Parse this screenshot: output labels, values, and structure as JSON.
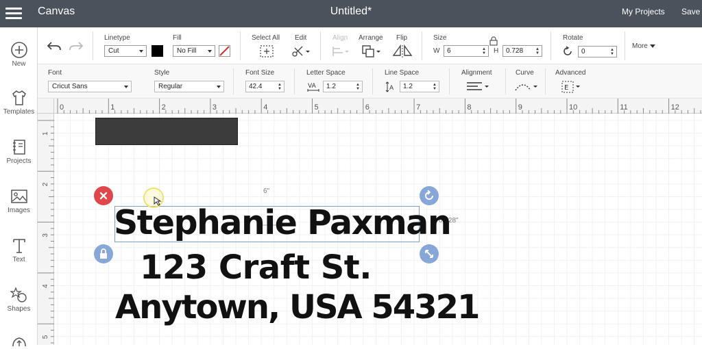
{
  "header": {
    "app_title": "Canvas",
    "doc_title": "Untitled*",
    "my_projects": "My Projects",
    "save": "Save"
  },
  "sidebar": {
    "items": [
      {
        "label": "New",
        "icon": "plus-circle-icon"
      },
      {
        "label": "Templates",
        "icon": "shirt-icon"
      },
      {
        "label": "Projects",
        "icon": "book-icon"
      },
      {
        "label": "Images",
        "icon": "image-icon"
      },
      {
        "label": "Text",
        "icon": "text-t-icon"
      },
      {
        "label": "Shapes",
        "icon": "shapes-icon"
      }
    ]
  },
  "toolbar": {
    "linetype_label": "Linetype",
    "linetype_value": "Cut",
    "fill_label": "Fill",
    "fill_value": "No Fill",
    "select_all_label": "Select All",
    "edit_label": "Edit",
    "align_label": "Align",
    "arrange_label": "Arrange",
    "flip_label": "Flip",
    "size_label": "Size",
    "w_label": "W",
    "w_value": "6",
    "h_label": "H",
    "h_value": "0.728",
    "rotate_label": "Rotate",
    "rotate_value": "0",
    "more_label": "More",
    "swatch_color": "#000000"
  },
  "text_toolbar": {
    "font_label": "Font",
    "font_value": "Cricut Sans",
    "style_label": "Style",
    "style_value": "Regular",
    "font_size_label": "Font Size",
    "font_size_value": "42.4",
    "letter_space_label": "Letter Space",
    "letter_space_value": "1.2",
    "line_space_label": "Line Space",
    "line_space_value": "1.2",
    "alignment_label": "Alignment",
    "curve_label": "Curve",
    "advanced_label": "Advanced"
  },
  "ruler": {
    "top_ticks": [
      "0",
      "1",
      "2",
      "3",
      "4",
      "5",
      "6",
      "7",
      "8",
      "9",
      "10",
      "11",
      "12"
    ],
    "left_ticks": [
      "1",
      "2",
      "3",
      "4",
      "5"
    ]
  },
  "canvas": {
    "text_lines": [
      "Stephanie Paxman",
      "123 Craft St.",
      "Anytown, USA 54321"
    ],
    "width_readout": "6\"",
    "height_readout": "0.728\"",
    "delete_color": "#e0474c",
    "handle_color": "#86a7d8"
  }
}
